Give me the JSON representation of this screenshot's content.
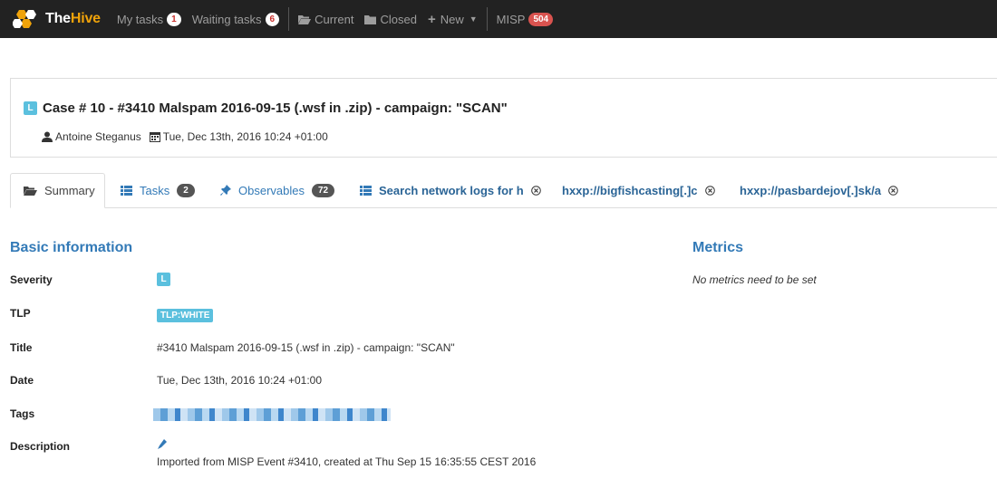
{
  "navbar": {
    "brand": {
      "the": "The",
      "hive": "Hive"
    },
    "items": [
      {
        "label": "My tasks",
        "badge": "1"
      },
      {
        "label": "Waiting tasks",
        "badge": "6"
      },
      {
        "label": "Current"
      },
      {
        "label": "Closed"
      },
      {
        "label": "New"
      },
      {
        "label": "MISP",
        "badge": "504"
      }
    ]
  },
  "case": {
    "severity": "L",
    "title": "Case # 10 - #3410 Malspam 2016-09-15 (.wsf in .zip) - campaign: \"SCAN\"",
    "owner": "Antoine Steganus",
    "date": "Tue, Dec 13th, 2016 10:24 +01:00"
  },
  "tabs": [
    {
      "label": "Summary",
      "icon": "folder-open-icon"
    },
    {
      "label": "Tasks",
      "badge": "2",
      "icon": "list-icon"
    },
    {
      "label": "Observables",
      "badge": "72",
      "icon": "pin-icon"
    },
    {
      "label": "Search network logs for h",
      "icon": "list-icon"
    },
    {
      "label": "hxxp://bigfishcasting[.]c"
    },
    {
      "label": "hxxp://pasbardejov[.]sk/a"
    }
  ],
  "basic": {
    "heading": "Basic information",
    "severity_label": "Severity",
    "severity_value": "L",
    "tlp_label": "TLP",
    "tlp_value": "TLP:WHITE",
    "title_label": "Title",
    "title_value": "#3410 Malspam 2016-09-15 (.wsf in .zip) - campaign: \"SCAN\"",
    "date_label": "Date",
    "date_value": "Tue, Dec 13th, 2016 10:24 +01:00",
    "tags_label": "Tags",
    "description_label": "Description",
    "description_value": "Imported from MISP Event #3410, created at Thu Sep 15 16:35:55 CEST 2016"
  },
  "metrics": {
    "heading": "Metrics",
    "empty": "No metrics need to be set"
  },
  "colors": {
    "accent": "#337ab7",
    "severity_low": "#5bc0de",
    "navbar": "#222222",
    "brand": "#f0a30a"
  }
}
